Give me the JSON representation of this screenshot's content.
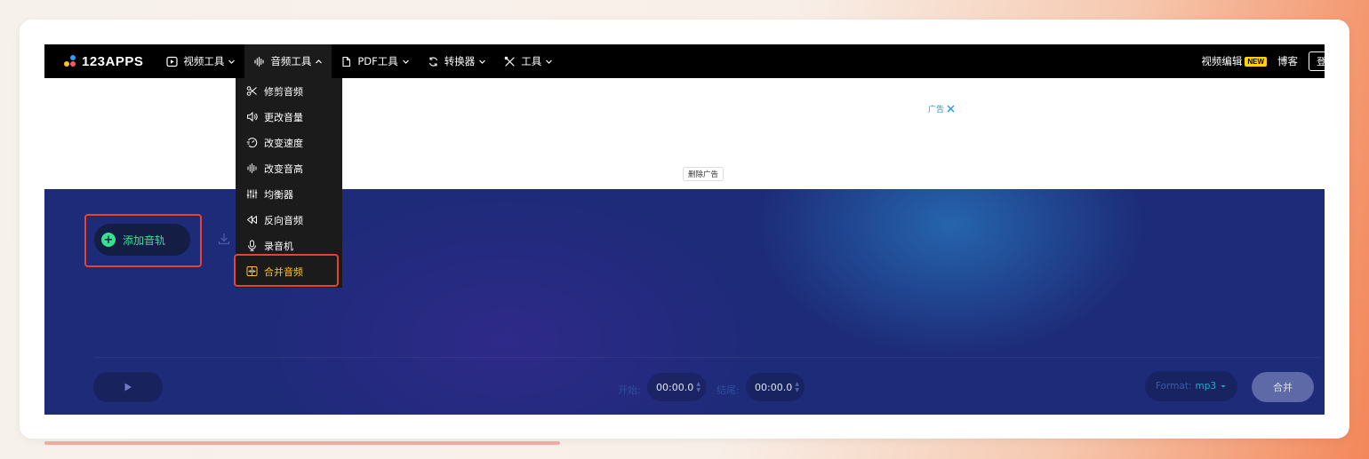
{
  "nav": {
    "logo": "123APPS",
    "items": [
      {
        "label": "视频工具",
        "icon": "play-square-icon"
      },
      {
        "label": "音频工具",
        "icon": "waveform-icon"
      },
      {
        "label": "PDF工具",
        "icon": "document-icon"
      },
      {
        "label": "转换器",
        "icon": "convert-icon"
      },
      {
        "label": "工具",
        "icon": "tools-icon"
      }
    ],
    "right": {
      "video_editor": "视频编辑",
      "new_badge": "NEW",
      "blog": "博客",
      "login": "登"
    }
  },
  "dropdown": {
    "items": [
      {
        "label": "修剪音频",
        "icon": "scissors-icon"
      },
      {
        "label": "更改音量",
        "icon": "volume-icon"
      },
      {
        "label": "改变速度",
        "icon": "speed-icon"
      },
      {
        "label": "改变音高",
        "icon": "pitch-icon"
      },
      {
        "label": "均衡器",
        "icon": "equalizer-icon"
      },
      {
        "label": "反向音频",
        "icon": "rewind-icon"
      },
      {
        "label": "录音机",
        "icon": "microphone-icon"
      },
      {
        "label": "合并音频",
        "icon": "merge-icon",
        "active": true
      }
    ]
  },
  "ad": {
    "label": "广告",
    "remove": "删除广告"
  },
  "editor": {
    "add_track": "添加音轨",
    "start_label": "开始:",
    "start_value": "00:00.0",
    "end_label": "结尾:",
    "end_value": "00:00.0",
    "format_label": "Format:",
    "format_value": "mp3",
    "merge_button": "合并"
  },
  "colors": {
    "accent_green": "#35e28e",
    "active_yellow": "#ffc21c",
    "highlight_red": "#e8442d",
    "editor_bg": "#1d2b78"
  }
}
